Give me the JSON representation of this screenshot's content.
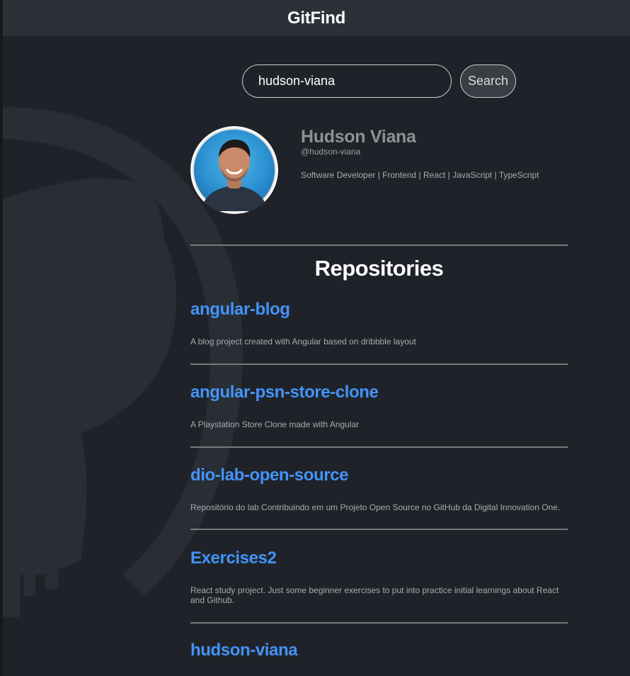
{
  "header": {
    "title": "GitFind"
  },
  "search": {
    "value": "hudson-viana",
    "button_label": "Search"
  },
  "profile": {
    "name": "Hudson Viana",
    "login": "@hudson-viana",
    "bio": "Software Developer | Frontend | React | JavaScript | TypeScript"
  },
  "repositories": {
    "title": "Repositories",
    "items": [
      {
        "name": "angular-blog",
        "description": "A blog project created with Angular based on dribbble layout"
      },
      {
        "name": "angular-psn-store-clone",
        "description": "A Playstation Store Clone made with Angular"
      },
      {
        "name": "dio-lab-open-source",
        "description": "Repositório do lab Contribuindo em um Projeto Open Source no GitHub da Digital Innovation One."
      },
      {
        "name": "Exercises2",
        "description": "React study project. Just some beginner exercises to put into practice initial learnings about React and Github."
      },
      {
        "name": "hudson-viana",
        "description": ""
      }
    ]
  },
  "colors": {
    "background": "#1f2329",
    "header": "#2b3137",
    "link": "#4493f8",
    "divider": "#767a7f"
  }
}
